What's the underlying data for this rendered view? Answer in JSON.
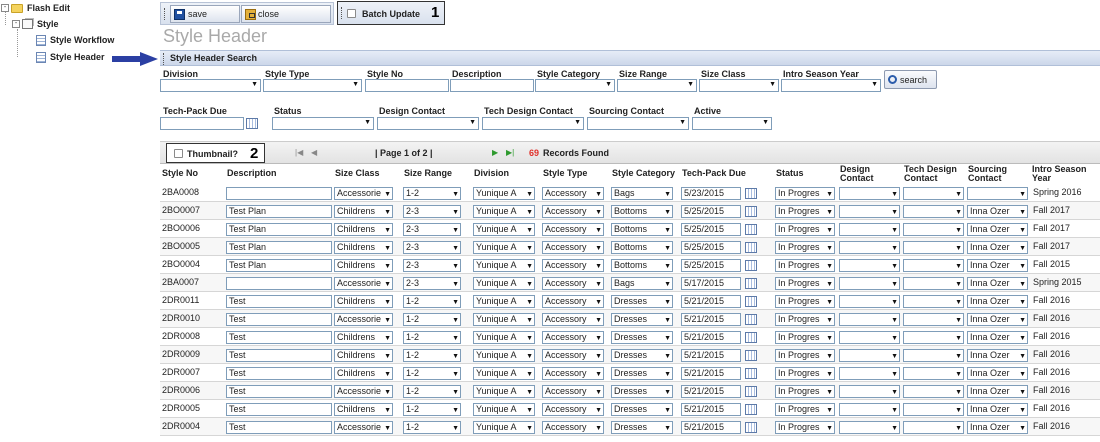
{
  "tree": {
    "root": {
      "expander": "-",
      "label": "Flash Edit",
      "icon": "folder-icon"
    },
    "child": {
      "expander": "-",
      "label": "Style",
      "icon": "style-icon"
    },
    "items": [
      {
        "label": "Style Workflow",
        "icon": "page-icon"
      },
      {
        "label": "Style Header",
        "icon": "page-icon"
      }
    ]
  },
  "toolbar": {
    "save_label": "save",
    "close_label": "close",
    "batch_update_label": "Batch Update",
    "annotation_1": "1"
  },
  "page_title": "Style Header",
  "search": {
    "section_title": "Style Header Search",
    "labels": {
      "division": "Division",
      "style_type": "Style Type",
      "style_no": "Style No",
      "description": "Description",
      "style_category": "Style Category",
      "size_range": "Size Range",
      "size_class": "Size Class",
      "intro_season_year": "Intro Season Year",
      "tech_pack_due": "Tech-Pack Due",
      "status": "Status",
      "design_contact": "Design Contact",
      "tech_design_contact": "Tech Design Contact",
      "sourcing_contact": "Sourcing Contact",
      "active": "Active"
    },
    "search_button": "search"
  },
  "pager": {
    "thumbnail_label": "Thumbnail?",
    "annotation_2": "2",
    "page_text": "| Page 1 of 2 |",
    "records_count": "69",
    "records_label": "Records Found",
    "records_color": "#e0302a"
  },
  "grid": {
    "columns": [
      "Style No",
      "Description",
      "Size Class",
      "Size Range",
      "Division",
      "Style Type",
      "Style Category",
      "Tech-Pack Due",
      "Status",
      "Design Contact",
      "Tech Design Contact",
      "Sourcing Contact",
      "Intro Season Year"
    ],
    "rows": [
      [
        "2BA0008",
        "",
        "Accessorie",
        "1-2",
        "Yunique A",
        "Accessory",
        "Bags",
        "5/23/2015",
        "In Progres",
        "",
        "",
        "",
        "Spring 2016"
      ],
      [
        "2BO0007",
        "Test Plan",
        "Childrens",
        "2-3",
        "Yunique A",
        "Accessory",
        "Bottoms",
        "5/25/2015",
        "In Progres",
        "",
        "",
        "Inna Ozer",
        "Fall 2017"
      ],
      [
        "2BO0006",
        "Test Plan",
        "Childrens",
        "2-3",
        "Yunique A",
        "Accessory",
        "Bottoms",
        "5/25/2015",
        "In Progres",
        "",
        "",
        "Inna Ozer",
        "Fall 2017"
      ],
      [
        "2BO0005",
        "Test Plan",
        "Childrens",
        "2-3",
        "Yunique A",
        "Accessory",
        "Bottoms",
        "5/25/2015",
        "In Progres",
        "",
        "",
        "Inna Ozer",
        "Fall 2017"
      ],
      [
        "2BO0004",
        "Test Plan",
        "Childrens",
        "2-3",
        "Yunique A",
        "Accessory",
        "Bottoms",
        "5/25/2015",
        "In Progres",
        "",
        "",
        "Inna Ozer",
        "Fall 2015"
      ],
      [
        "2BA0007",
        "",
        "Accessorie",
        "2-3",
        "Yunique A",
        "Accessory",
        "Bags",
        "5/17/2015",
        "In Progres",
        "",
        "",
        "Inna Ozer",
        "Spring 2015"
      ],
      [
        "2DR0011",
        "Test",
        "Childrens",
        "1-2",
        "Yunique A",
        "Accessory",
        "Dresses",
        "5/21/2015",
        "In Progres",
        "",
        "",
        "Inna Ozer",
        "Fall 2016"
      ],
      [
        "2DR0010",
        "Test",
        "Accessorie",
        "1-2",
        "Yunique A",
        "Accessory",
        "Dresses",
        "5/21/2015",
        "In Progres",
        "",
        "",
        "Inna Ozer",
        "Fall 2016"
      ],
      [
        "2DR0008",
        "Test",
        "Childrens",
        "1-2",
        "Yunique A",
        "Accessory",
        "Dresses",
        "5/21/2015",
        "In Progres",
        "",
        "",
        "Inna Ozer",
        "Fall 2016"
      ],
      [
        "2DR0009",
        "Test",
        "Childrens",
        "1-2",
        "Yunique A",
        "Accessory",
        "Dresses",
        "5/21/2015",
        "In Progres",
        "",
        "",
        "Inna Ozer",
        "Fall 2016"
      ],
      [
        "2DR0007",
        "Test",
        "Childrens",
        "1-2",
        "Yunique A",
        "Accessory",
        "Dresses",
        "5/21/2015",
        "In Progres",
        "",
        "",
        "Inna Ozer",
        "Fall 2016"
      ],
      [
        "2DR0006",
        "Test",
        "Accessorie",
        "1-2",
        "Yunique A",
        "Accessory",
        "Dresses",
        "5/21/2015",
        "In Progres",
        "",
        "",
        "Inna Ozer",
        "Fall 2016"
      ],
      [
        "2DR0005",
        "Test",
        "Childrens",
        "1-2",
        "Yunique A",
        "Accessory",
        "Dresses",
        "5/21/2015",
        "In Progres",
        "",
        "",
        "Inna Ozer",
        "Fall 2016"
      ],
      [
        "2DR0004",
        "Test",
        "Accessorie",
        "1-2",
        "Yunique A",
        "Accessory",
        "Dresses",
        "5/21/2015",
        "In Progres",
        "",
        "",
        "Inna Ozer",
        "Fall 2016"
      ]
    ]
  },
  "colors": {
    "accent": "#2b4fa0",
    "header_gradient": "#d9e1ee",
    "arrow": "#2b3fa3"
  }
}
